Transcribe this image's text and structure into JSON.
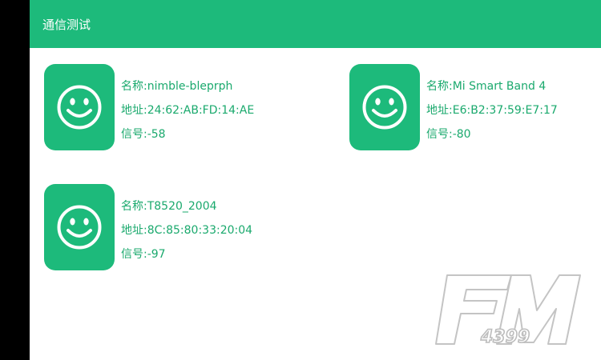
{
  "app_bar": {
    "title": "通信测试",
    "color": "#1dba7b"
  },
  "devices": [
    {
      "icon": "smiley-icon",
      "name_label": "名称:",
      "name": "nimble-bleprph",
      "address_label": "地址:",
      "address": "24:62:AB:FD:14:AE",
      "signal_label": "信号:",
      "signal": "-58"
    },
    {
      "icon": "smiley-icon",
      "name_label": "名称:",
      "name": "Mi Smart Band 4",
      "address_label": "地址:",
      "address": "E6:B2:37:59:E7:17",
      "signal_label": "信号:",
      "signal": "-80"
    },
    {
      "icon": "smiley-icon",
      "name_label": "名称:",
      "name": "T8520_2004",
      "address_label": "地址:",
      "address": "8C:85:80:33:20:04",
      "signal_label": "信号:",
      "signal": "-97"
    }
  ],
  "watermark": {
    "letters": "FM",
    "number": "4399"
  },
  "colors": {
    "accent": "#1dba7b",
    "text_accent": "#1aa96d",
    "background": "#ffffff"
  }
}
